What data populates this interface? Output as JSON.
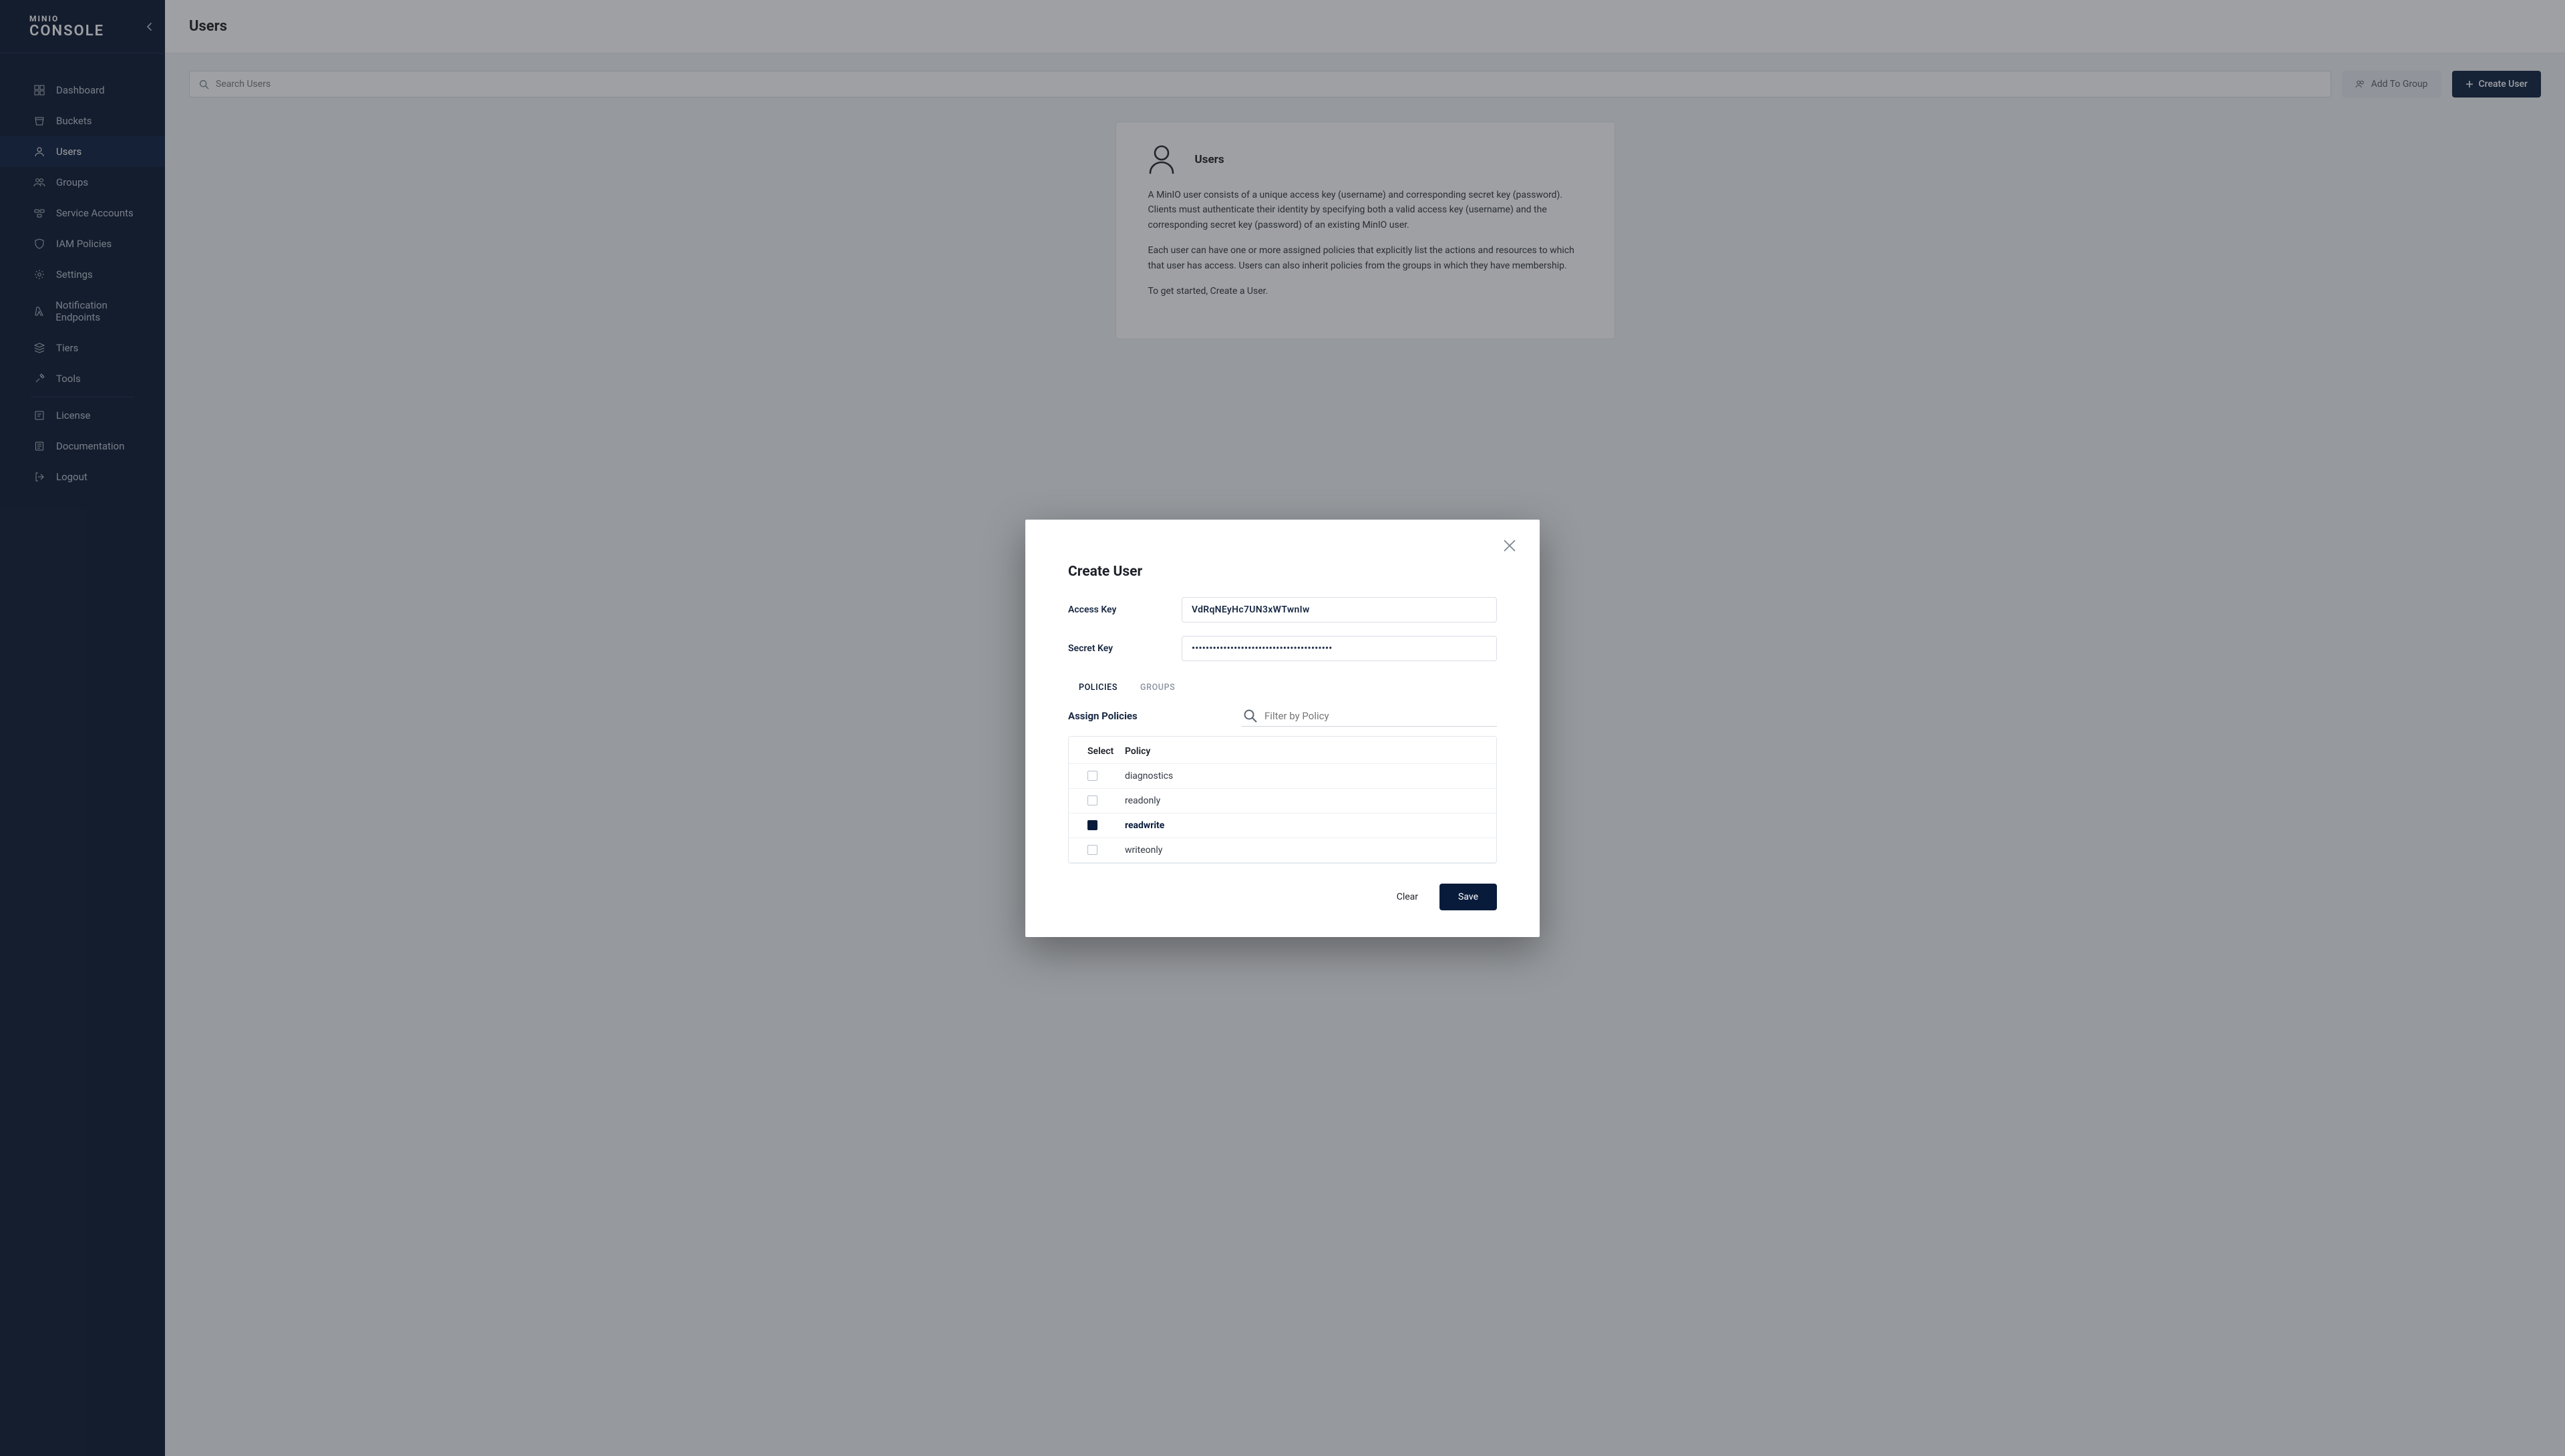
{
  "brand": {
    "line1": "MINIO",
    "line2": "CONSOLE"
  },
  "sidebar": {
    "items": [
      {
        "label": "Dashboard",
        "icon": "dashboard-icon"
      },
      {
        "label": "Buckets",
        "icon": "bucket-icon"
      },
      {
        "label": "Users",
        "icon": "user-icon",
        "active": true
      },
      {
        "label": "Groups",
        "icon": "groups-icon"
      },
      {
        "label": "Service Accounts",
        "icon": "service-accounts-icon"
      },
      {
        "label": "IAM Policies",
        "icon": "shield-icon"
      },
      {
        "label": "Settings",
        "icon": "gear-icon"
      },
      {
        "label": "Notification Endpoints",
        "icon": "lambda-icon"
      },
      {
        "label": "Tiers",
        "icon": "tiers-icon"
      },
      {
        "label": "Tools",
        "icon": "tools-icon"
      }
    ],
    "footer": [
      {
        "label": "License",
        "icon": "license-icon"
      },
      {
        "label": "Documentation",
        "icon": "doc-icon"
      },
      {
        "label": "Logout",
        "icon": "logout-icon"
      }
    ]
  },
  "page": {
    "title": "Users",
    "search_placeholder": "Search Users",
    "add_to_group_label": "Add To Group",
    "create_user_label": "Create User"
  },
  "info_card": {
    "title": "Users",
    "p1": "A MinIO user consists of a unique access key (username) and corresponding secret key (password). Clients must authenticate their identity by specifying both a valid access key (username) and the corresponding secret key (password) of an existing MinIO user.",
    "p2": "Each user can have one or more assigned policies that explicitly list the actions and resources to which that user has access. Users can also inherit policies from the groups in which they have membership.",
    "p3": "To get started, Create a User."
  },
  "dialog": {
    "title": "Create User",
    "access_key_label": "Access Key",
    "access_key_value": "VdRqNEyHc7UN3xWTwnIw",
    "secret_key_label": "Secret Key",
    "secret_key_value": "••••••••••••••••••••••••••••••••••••••••",
    "tabs": {
      "policies": "POLICIES",
      "groups": "GROUPS"
    },
    "assign_label": "Assign Policies",
    "filter_placeholder": "Filter by Policy",
    "table": {
      "col_select": "Select",
      "col_policy": "Policy",
      "rows": [
        {
          "name": "diagnostics",
          "selected": false
        },
        {
          "name": "readonly",
          "selected": false
        },
        {
          "name": "readwrite",
          "selected": true
        },
        {
          "name": "writeonly",
          "selected": false
        }
      ]
    },
    "clear_label": "Clear",
    "save_label": "Save"
  }
}
